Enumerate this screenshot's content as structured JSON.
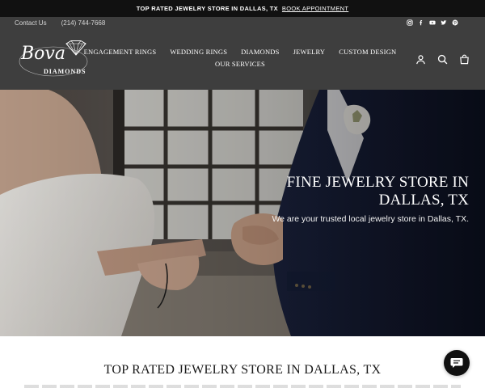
{
  "announcement": {
    "text": "TOP RATED JEWELRY STORE IN DALLAS, TX",
    "link_label": "BOOK APPOINTMENT"
  },
  "utility": {
    "contact_label": "Contact Us",
    "phone": "(214) 744-7668"
  },
  "social_icons": [
    "instagram-icon",
    "facebook-icon",
    "youtube-icon",
    "twitter-icon",
    "pinterest-icon"
  ],
  "logo": {
    "script": "Bova",
    "sub": "DIAMONDS"
  },
  "nav": {
    "row1": [
      "ENGAGEMENT RINGS",
      "WEDDING RINGS",
      "DIAMONDS",
      "JEWELRY",
      "CUSTOM DESIGN"
    ],
    "row2": [
      "OUR SERVICES"
    ]
  },
  "header_icons": [
    "account-icon",
    "search-icon",
    "cart-icon"
  ],
  "hero": {
    "title": "FINE JEWELRY STORE IN DALLAS, TX",
    "subtitle": "We are your trusted local jewelry store in Dallas, TX."
  },
  "section": {
    "title": "TOP RATED JEWELRY STORE IN DALLAS, TX"
  },
  "chat_icon": "chat-bubble-icon",
  "colors": {
    "announcement_bg": "#111111",
    "header_bg": "#3e3e3e",
    "text_dark": "#1a1a1a"
  }
}
